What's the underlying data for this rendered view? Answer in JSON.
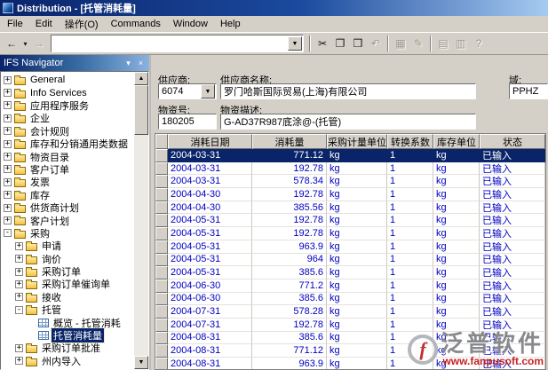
{
  "window": {
    "title": "Distribution - [托管消耗量]"
  },
  "menu": {
    "items": [
      "File",
      "Edit",
      "操作(O)",
      "Commands",
      "Window",
      "Help"
    ]
  },
  "icons": {
    "dropdown": "▼",
    "scroll_up": "▲",
    "scroll_down": "▼"
  },
  "toolbar": {
    "items": [
      {
        "type": "button",
        "name": "back",
        "glyph": "←"
      },
      {
        "type": "button",
        "name": "back-history-dropdown",
        "glyph": "▾",
        "small": true
      },
      {
        "type": "button",
        "name": "forward",
        "glyph": "→",
        "disabled": true
      },
      {
        "type": "combo",
        "name": "navigator-address",
        "value": ""
      },
      {
        "type": "sep"
      },
      {
        "type": "button",
        "name": "cut",
        "glyph": "✂"
      },
      {
        "type": "button",
        "name": "copy",
        "glyph": "❐"
      },
      {
        "type": "button",
        "name": "paste",
        "glyph": "❒"
      },
      {
        "type": "button",
        "name": "undo",
        "glyph": "↶",
        "disabled": true
      },
      {
        "type": "sep"
      },
      {
        "type": "button",
        "name": "query",
        "glyph": "▦",
        "disabled": true
      },
      {
        "type": "button",
        "name": "edit",
        "glyph": "✎",
        "disabled": true
      },
      {
        "type": "sep"
      },
      {
        "type": "button",
        "name": "list-view",
        "glyph": "▤",
        "disabled": true
      },
      {
        "type": "button",
        "name": "detail-view",
        "glyph": "▥",
        "disabled": true
      },
      {
        "type": "button",
        "name": "help",
        "glyph": "?",
        "disabled": true
      }
    ]
  },
  "navigator": {
    "title": "IFS Navigator",
    "header_icons": [
      "▾",
      "×"
    ],
    "items": [
      {
        "label": "General",
        "level": 0,
        "expander": "plus",
        "icon": "folder"
      },
      {
        "label": "Info Services",
        "level": 0,
        "expander": "plus",
        "icon": "folder"
      },
      {
        "label": "应用程序服务",
        "level": 0,
        "expander": "plus",
        "icon": "folder"
      },
      {
        "label": "企业",
        "level": 0,
        "expander": "plus",
        "icon": "folder"
      },
      {
        "label": "会计规则",
        "level": 0,
        "expander": "plus",
        "icon": "folder"
      },
      {
        "label": "库存和分销通用类数据",
        "level": 0,
        "expander": "plus",
        "icon": "folder"
      },
      {
        "label": "物资目录",
        "level": 0,
        "expander": "plus",
        "icon": "folder"
      },
      {
        "label": "客户订单",
        "level": 0,
        "expander": "plus",
        "icon": "folder"
      },
      {
        "label": "发票",
        "level": 0,
        "expander": "plus",
        "icon": "folder"
      },
      {
        "label": "库存",
        "level": 0,
        "expander": "plus",
        "icon": "folder"
      },
      {
        "label": "供货商计划",
        "level": 0,
        "expander": "plus",
        "icon": "folder"
      },
      {
        "label": "客户计划",
        "level": 0,
        "expander": "plus",
        "icon": "folder"
      },
      {
        "label": "采购",
        "level": 0,
        "expander": "minus",
        "icon": "folder"
      },
      {
        "label": "申请",
        "level": 1,
        "expander": "plus",
        "icon": "folder"
      },
      {
        "label": "询价",
        "level": 1,
        "expander": "plus",
        "icon": "folder"
      },
      {
        "label": "采购订单",
        "level": 1,
        "expander": "plus",
        "icon": "folder"
      },
      {
        "label": "采购订单催询单",
        "level": 1,
        "expander": "plus",
        "icon": "folder"
      },
      {
        "label": "接收",
        "level": 1,
        "expander": "plus",
        "icon": "folder"
      },
      {
        "label": "托管",
        "level": 1,
        "expander": "minus",
        "icon": "folder"
      },
      {
        "label": "概览 - 托管消耗",
        "level": 2,
        "expander": "none",
        "icon": "grid"
      },
      {
        "label": "托管消耗量",
        "level": 2,
        "expander": "none",
        "icon": "grid",
        "selected": true
      },
      {
        "label": "采购订单批准",
        "level": 1,
        "expander": "plus",
        "icon": "folder"
      },
      {
        "label": "州内导入",
        "level": 1,
        "expander": "plus",
        "icon": "folder"
      }
    ]
  },
  "form": {
    "supplier_label": "供应商:",
    "supplier_value": "6074",
    "supplier_name_label": "供应商名称:",
    "supplier_name_value": "罗门哈斯国际贸易(上海)有限公司",
    "domain_label": "域:",
    "domain_value": "PPHZ",
    "part_label": "物资号:",
    "part_value": "180205",
    "part_desc_label": "物资描述:",
    "part_desc_value": "G-AD37R987底涂@-(托管)"
  },
  "table": {
    "columns": [
      "消耗日期",
      "消耗量",
      "采购计量单位",
      "转换系数",
      "库存单位",
      "状态"
    ],
    "selected_row": 0,
    "rows": [
      [
        "2004-03-31",
        "771.12",
        "kg",
        "1",
        "kg",
        "已输入"
      ],
      [
        "2004-03-31",
        "192.78",
        "kg",
        "1",
        "kg",
        "已输入"
      ],
      [
        "2004-03-31",
        "578.34",
        "kg",
        "1",
        "kg",
        "已输入"
      ],
      [
        "2004-04-30",
        "192.78",
        "kg",
        "1",
        "kg",
        "已输入"
      ],
      [
        "2004-04-30",
        "385.56",
        "kg",
        "1",
        "kg",
        "已输入"
      ],
      [
        "2004-05-31",
        "192.78",
        "kg",
        "1",
        "kg",
        "已输入"
      ],
      [
        "2004-05-31",
        "192.78",
        "kg",
        "1",
        "kg",
        "已输入"
      ],
      [
        "2004-05-31",
        "963.9",
        "kg",
        "1",
        "kg",
        "已输入"
      ],
      [
        "2004-05-31",
        "964",
        "kg",
        "1",
        "kg",
        "已输入"
      ],
      [
        "2004-05-31",
        "385.6",
        "kg",
        "1",
        "kg",
        "已输入"
      ],
      [
        "2004-06-30",
        "771.2",
        "kg",
        "1",
        "kg",
        "已输入"
      ],
      [
        "2004-06-30",
        "385.6",
        "kg",
        "1",
        "kg",
        "已输入"
      ],
      [
        "2004-07-31",
        "578.28",
        "kg",
        "1",
        "kg",
        "已输入"
      ],
      [
        "2004-07-31",
        "192.78",
        "kg",
        "1",
        "kg",
        "已输入"
      ],
      [
        "2004-08-31",
        "385.6",
        "kg",
        "1",
        "kg",
        "已输入"
      ],
      [
        "2004-08-31",
        "771.12",
        "kg",
        "1",
        "kg",
        "已输入"
      ],
      [
        "2004-08-31",
        "963.9",
        "kg",
        "1",
        "kg",
        "已输入"
      ]
    ]
  },
  "watermark": {
    "logo_glyph": "f",
    "brand": "泛普软件",
    "url": "www.fanpusoft.com"
  }
}
